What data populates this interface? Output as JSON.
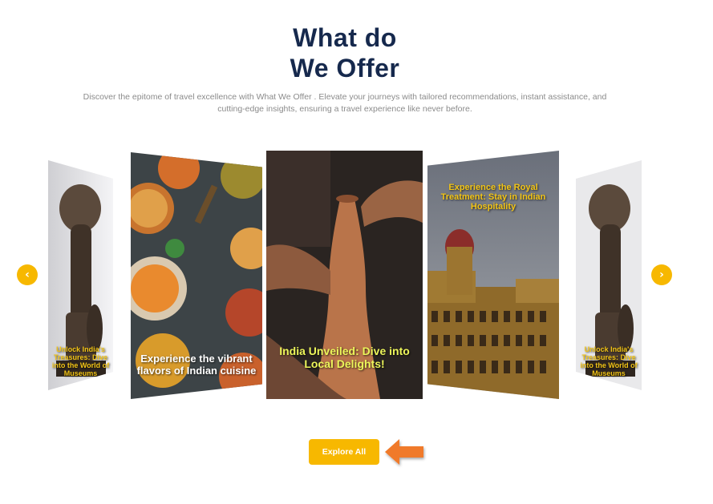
{
  "section": {
    "title_line1": "What do",
    "title_line2": "We Offer",
    "description_line1": "Discover the epitome of travel excellence with What We Offer . Elevate your journeys with tailored recommendations, instant assistance, and",
    "description_line2": "cutting-edge insights, ensuring a travel experience like never before."
  },
  "carousel": {
    "cards": [
      {
        "caption": "Unlock India's Treasures: Dive into the World of Museums",
        "image": "stone-sculpture"
      },
      {
        "caption": "Experience the vibrant flavors of Indian cuisine",
        "image": "indian-food-platter"
      },
      {
        "caption": "India Unveiled: Dive into Local Delights!",
        "image": "pottery-wheel"
      },
      {
        "caption": "Experience the Royal Treatment: Stay in Indian Hospitality",
        "image": "palace-hotel"
      },
      {
        "caption": "Unlock India's Treasures: Dive into the World of Museums",
        "image": "stone-sculpture"
      }
    ],
    "prev_icon": "chevron-left-icon",
    "next_icon": "chevron-right-icon"
  },
  "cta": {
    "explore_label": "Explore All",
    "pointer_icon": "arrow-left-icon"
  },
  "colors": {
    "title": "#16294d",
    "accent": "#f7b800",
    "description": "#8b8b8b",
    "arrow": "#f07a2a"
  }
}
